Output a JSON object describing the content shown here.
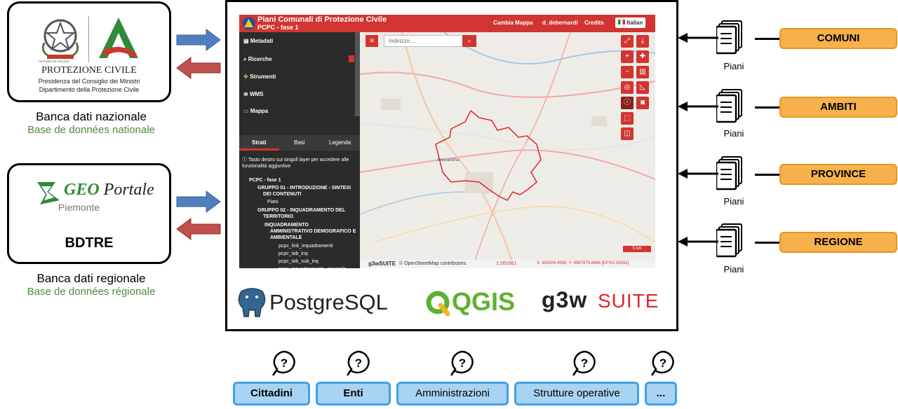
{
  "left": {
    "national": {
      "logo_text": "PROTEZIONE CIVILE",
      "logo_line1": "Presidenza del Consiglio dei Ministri",
      "logo_line2": "Dipartimento della Protezione Civile",
      "seal_text": "REPUBBLICA ITALIANA",
      "caption": "Banca dati nazionale",
      "caption_fr": "Base de données nationale"
    },
    "regional": {
      "logo_geo": "GEO",
      "logo_portale": "Portale",
      "logo_region": "Piemonte",
      "label": "BDTRE",
      "caption": "Banca dati regionale",
      "caption_fr": "Base de données régionale"
    }
  },
  "app": {
    "title": "Piani Comunali di Protezione Civile",
    "subtitle": "PCPC - fase 1",
    "menu": [
      "Cambia Mappa",
      "d_debernardi",
      "Credits",
      "Italian"
    ],
    "sidebar": [
      "Metadati",
      "Ricerche",
      "Strumenti",
      "WMS",
      "Mappa"
    ],
    "tabs": [
      "Strati",
      "Basi",
      "Legenda"
    ],
    "info": "Tasto destro sui singoli layer per accedere alle funzionalità aggiuntive",
    "tree": [
      "PCPC - fase 1",
      "GRUPPO 01 - INTRODUZIONE - SINTESI",
      "DEI CONTENUTI",
      "Piani",
      "GRUPPO 02 - INQUADRAMENTO DEL",
      "TERRITORIO",
      "INQUADRAMENTO",
      "AMMINISTRATIVO DEMOGRAFICO E",
      "AMBIENTALE",
      "pcpc_link_inquadramenti",
      "pcpc_tab_inq",
      "pcpc_tab_sub_inq",
      "pcpc_inquadramento_generale"
    ],
    "search_placeholder": "Indirizzo ...",
    "map_city": "Alessandria",
    "footer_brand": "g3wSUITE",
    "footer_attr": "© OpenStreetMap contributors.",
    "footer_scale": "1:261061",
    "footer_coords": "X: 459504.4560, Y: 4967879.6696  [EPSG:32632]",
    "scale_bar": "5 km"
  },
  "logos": {
    "postgres": "PostgreSQL",
    "qgis": "QGIS",
    "g3w": "g3w",
    "suite": "SUITE"
  },
  "levels": [
    {
      "label": "COMUNI",
      "doc": "Piani"
    },
    {
      "label": "AMBITI",
      "doc": "Piani"
    },
    {
      "label": "PROVINCE",
      "doc": "Piani"
    },
    {
      "label": "REGIONE",
      "doc": "Piani"
    }
  ],
  "users": [
    "Cittadini",
    "Enti",
    "Amministrazioni",
    "Strutture operative",
    "..."
  ],
  "colors": {
    "accent_red": "#d23431",
    "level_fill": "#f7b14c",
    "user_fill": "#a9d3f2",
    "arrow_blue": "#4f7fc1",
    "arrow_red": "#c0504d",
    "green_caption": "#4a8a3a"
  }
}
